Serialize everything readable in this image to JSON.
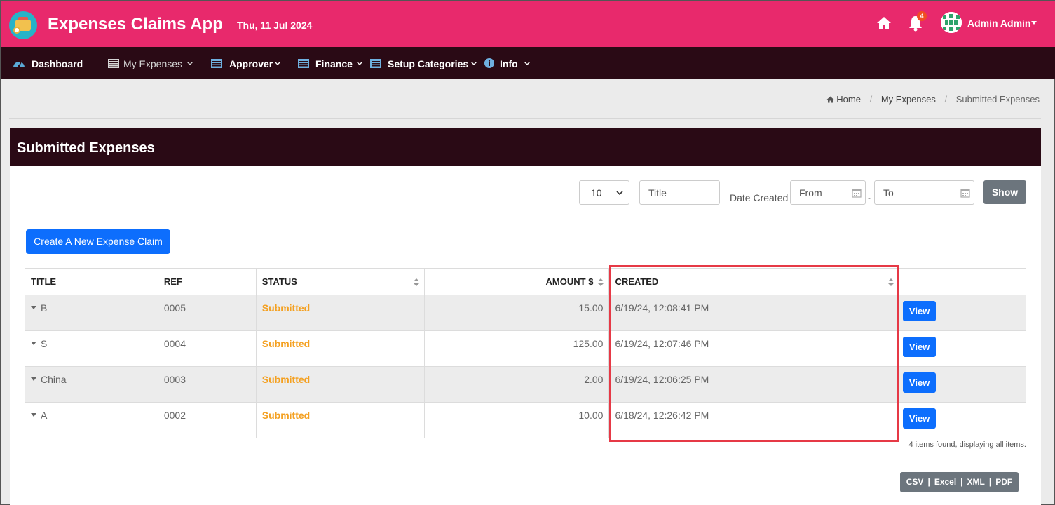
{
  "header": {
    "title": "Expenses Claims App",
    "date": "Thu, 11 Jul 2024",
    "notifications_count": "4",
    "user_name": "Admin Admin",
    "brand_color": "#e8296c",
    "icons": [
      "home-icon",
      "bell-icon",
      "avatar"
    ]
  },
  "nav": {
    "items": [
      {
        "label": "Dashboard",
        "icon": "dashboard-icon"
      },
      {
        "label": "My Expenses",
        "icon": "list-icon"
      },
      {
        "label": "Approver",
        "icon": "list-icon"
      },
      {
        "label": "Finance",
        "icon": "list-icon"
      },
      {
        "label": "Setup Categories",
        "icon": "list-icon"
      },
      {
        "label": "Info",
        "icon": "info-icon"
      }
    ]
  },
  "breadcrumb": {
    "home": "Home",
    "parent": "My Expenses",
    "current": "Submitted Expenses"
  },
  "panel": {
    "title": "Submitted Expenses"
  },
  "filters": {
    "page_size": "10",
    "title_placeholder": "Title",
    "date_label": "Date Created",
    "from_placeholder": "From",
    "separator": "-",
    "to_placeholder": "To",
    "show_label": "Show"
  },
  "create_label": "Create A New Expense Claim",
  "table": {
    "columns": [
      "TITLE",
      "REF",
      "STATUS",
      "AMOUNT $",
      "CREATED"
    ],
    "rows": [
      {
        "title": "B",
        "ref": "0005",
        "status": "Submitted",
        "amount": "15.00",
        "created": "6/19/24, 12:08:41 PM",
        "action": "View"
      },
      {
        "title": "S",
        "ref": "0004",
        "status": "Submitted",
        "amount": "125.00",
        "created": "6/19/24, 12:07:46 PM",
        "action": "View"
      },
      {
        "title": "China",
        "ref": "0003",
        "status": "Submitted",
        "amount": "2.00",
        "created": "6/19/24, 12:06:25 PM",
        "action": "View"
      },
      {
        "title": "A",
        "ref": "0002",
        "status": "Submitted",
        "amount": "10.00",
        "created": "6/18/24, 12:26:42 PM",
        "action": "View"
      }
    ],
    "summary": "4 items found, displaying all items."
  },
  "exports": {
    "csv": "CSV",
    "excel": "Excel",
    "xml": "XML",
    "pdf": "PDF",
    "sep": "|"
  },
  "colors": {
    "status_submitted": "#f4a020",
    "primary_button": "#0d6efd",
    "highlight": "#e63946"
  }
}
